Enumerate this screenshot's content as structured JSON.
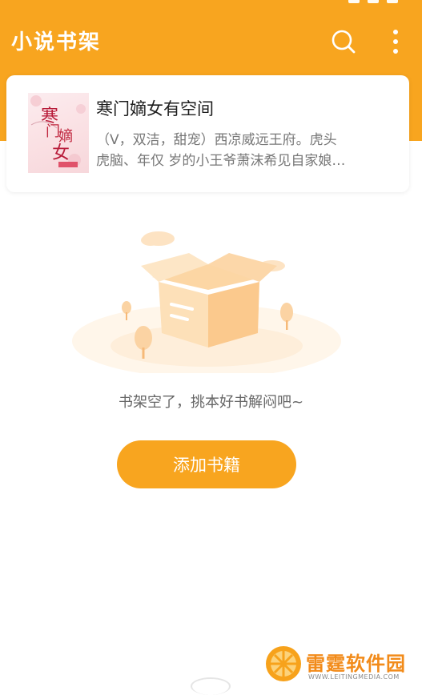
{
  "header": {
    "title": "小说书架",
    "search_icon": "search-icon",
    "more_icon": "more-vertical-icon"
  },
  "book": {
    "title": "寒门嫡女有空间",
    "desc_line1": "（V，双洁，甜宠）西凉威远王府。虎头",
    "desc_line2": "虎脑、年仅 岁的小王爷萧沫希见自家娘…",
    "cover_text": "寒门嫡女"
  },
  "empty_state": {
    "illustration": "empty-box-icon",
    "message": "书架空了，挑本好书解闷吧~"
  },
  "actions": {
    "add_books_label": "添加书籍"
  },
  "watermark": {
    "name": "雷霆软件园",
    "url": "WWW.LEITINGMEDIA.COM"
  },
  "colors": {
    "accent": "#f8a51f",
    "box": "#fbd4a3",
    "text_dark": "#1e1e1e",
    "text_muted": "#777777"
  }
}
